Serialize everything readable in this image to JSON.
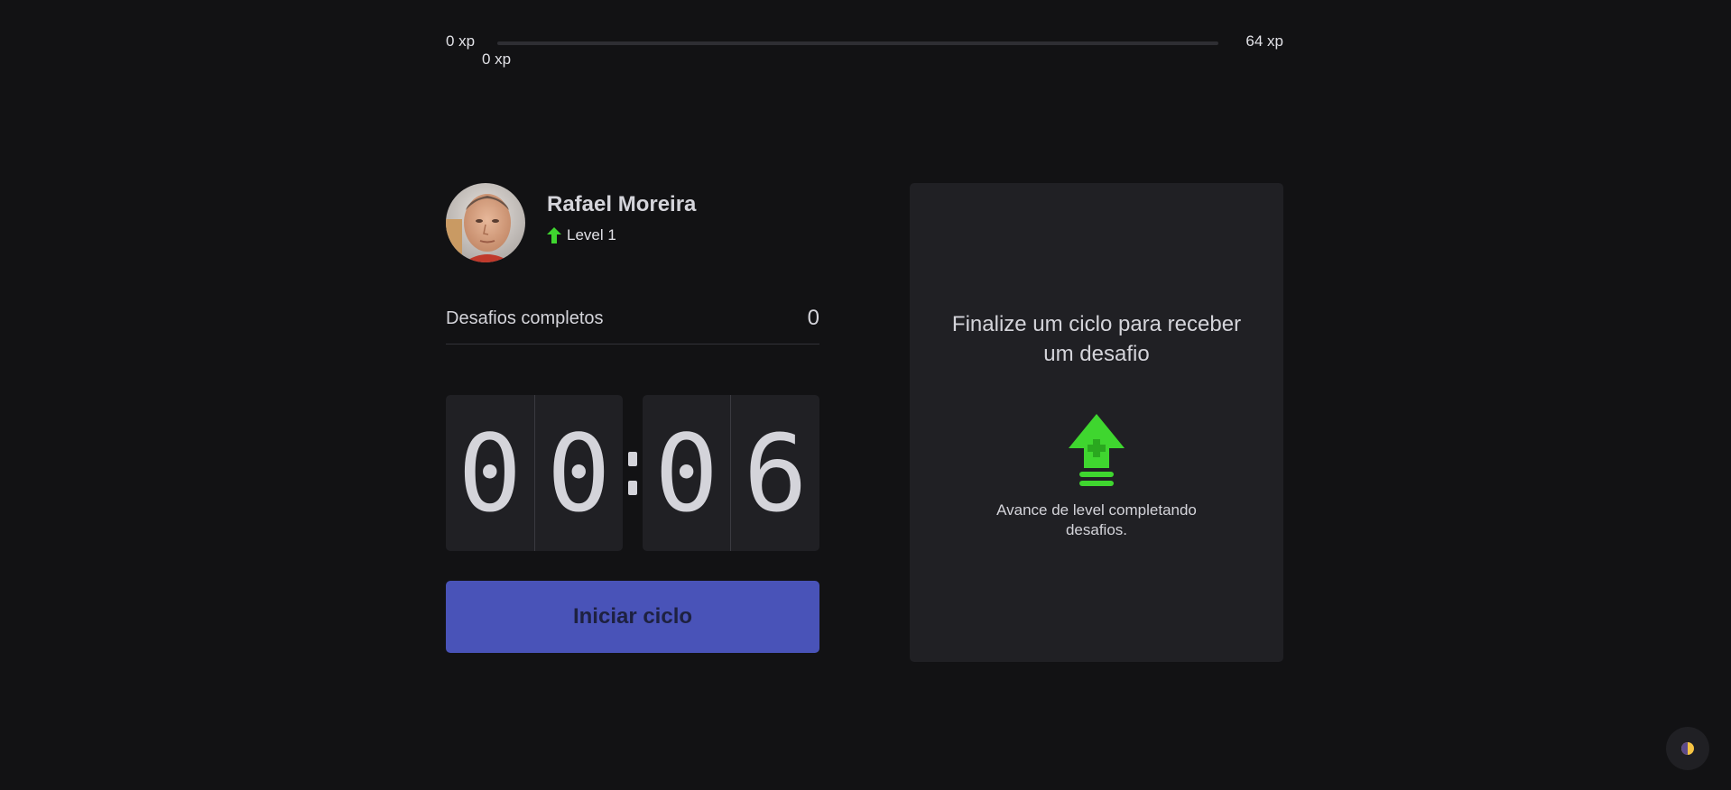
{
  "xp": {
    "min_label": "0 xp",
    "max_label": "64 xp",
    "current_label": "0 xp",
    "progress": 0,
    "fill_color": "#04d361"
  },
  "profile": {
    "name": "Rafael Moreira",
    "level_label": "Level 1",
    "level_icon": "level-up-arrow-icon"
  },
  "challenges": {
    "label": "Desafios completos",
    "count": "0"
  },
  "countdown": {
    "minute_left": "0",
    "minute_right": "0",
    "second_left": "0",
    "second_right": "6"
  },
  "start_button": {
    "label": "Iniciar ciclo",
    "color": "#4953b8"
  },
  "challenge_card": {
    "title": "Finalize um ciclo para receber um desafio",
    "icon": "level-up-icon",
    "description": "Avance de level completando desafios."
  },
  "theme_toggle": {
    "icon": "theme-toggle-icon"
  },
  "colors": {
    "background": "#121214",
    "card": "#202024",
    "accent_green": "#3fd62f",
    "accent_blue": "#4953b8"
  }
}
